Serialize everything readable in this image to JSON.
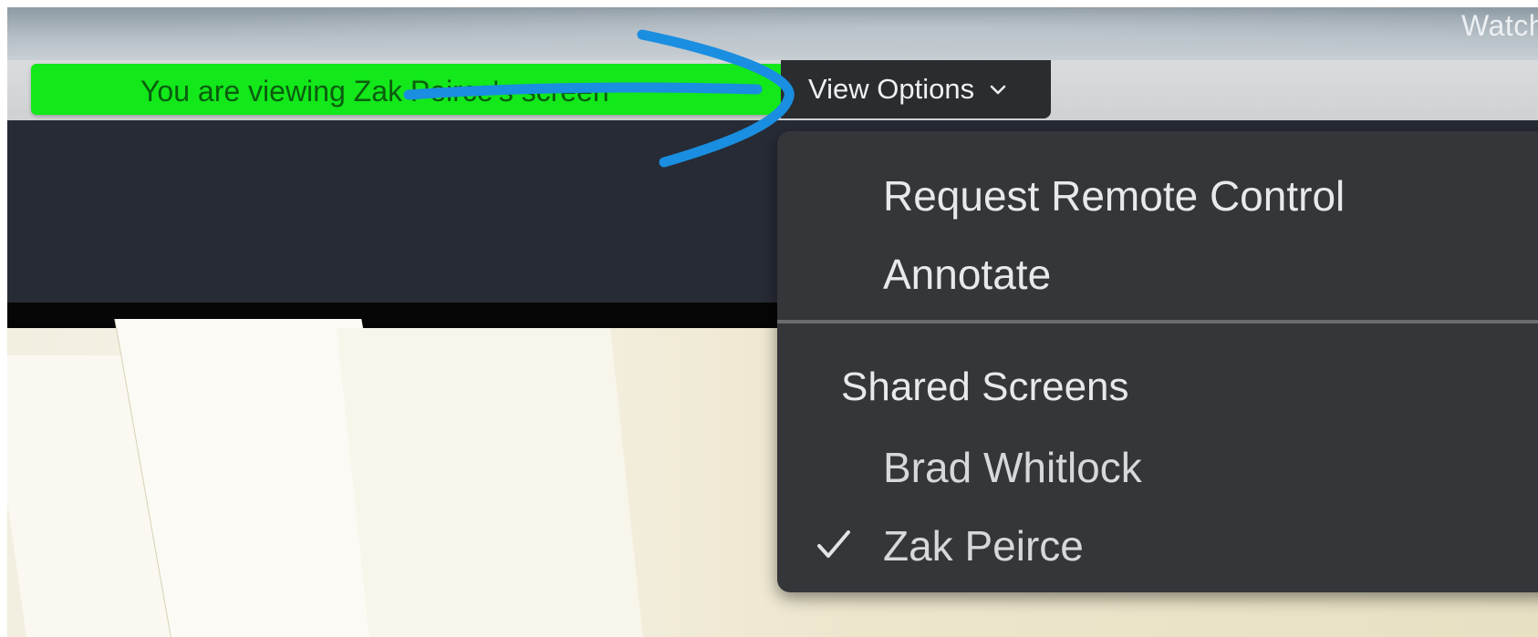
{
  "video": {
    "watch_label": "Watch"
  },
  "share_bar": {
    "viewing_text": "You are viewing Zak Peirce's screen",
    "view_options_label": "View Options"
  },
  "menu": {
    "items": [
      {
        "label": "Request Remote Control"
      },
      {
        "label": "Annotate"
      }
    ],
    "shared_screens_header": "Shared Screens",
    "screens": [
      {
        "label": "Brad Whitlock",
        "selected": false
      },
      {
        "label": "Zak Peirce",
        "selected": true
      }
    ]
  },
  "icons": {
    "chevron": "chevron-down-icon",
    "check": "check-icon"
  },
  "colors": {
    "viewing_banner": "#12e81a",
    "menu_background": "#34363a",
    "toolbar_dark": "#272b35",
    "annotation": "#1a8ee0"
  }
}
